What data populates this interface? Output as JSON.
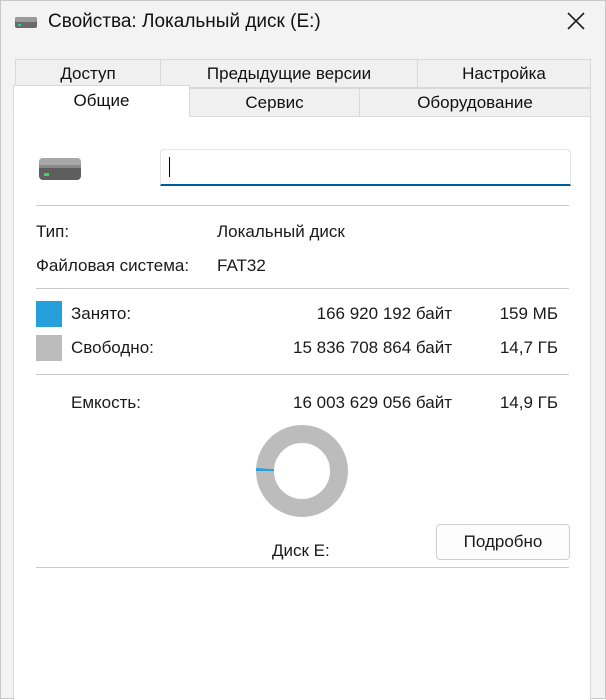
{
  "window": {
    "title": "Свойства: Локальный диск (E:)",
    "close_icon": "close-icon",
    "title_icon": "drive-icon"
  },
  "tabs": {
    "row1": [
      "Доступ",
      "Предыдущие версии",
      "Настройка"
    ],
    "row2": [
      "Общие",
      "Сервис",
      "Оборудование"
    ],
    "active": "Общие"
  },
  "general": {
    "name_value": "",
    "type_label": "Тип:",
    "type_value": "Локальный диск",
    "fs_label": "Файловая система:",
    "fs_value": "FAT32",
    "used": {
      "label": "Занято:",
      "bytes": "166 920 192 байт",
      "size": "159 МБ",
      "color": "#26a0da"
    },
    "free": {
      "label": "Свободно:",
      "bytes": "15 836 708 864 байт",
      "size": "14,7 ГБ",
      "color": "#bcbcbc"
    },
    "capacity": {
      "label": "Емкость:",
      "bytes": "16 003 629 056 байт",
      "size": "14,9 ГБ"
    },
    "used_fraction": 0.0104,
    "disk_label": "Диск E:",
    "details_button": "Подробно"
  }
}
